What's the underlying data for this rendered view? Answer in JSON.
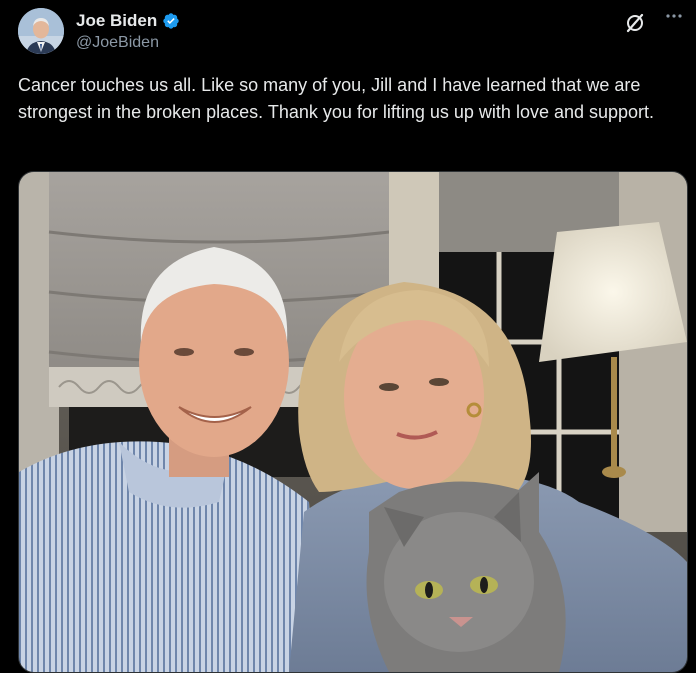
{
  "author": {
    "display_name": "Joe Biden",
    "handle": "@JoeBiden",
    "verified": true,
    "verified_color": "#1d9bf0"
  },
  "icons": {
    "verified": "verified-badge-icon",
    "grok": "grok-icon",
    "more": "more-options-icon"
  },
  "tweet": {
    "text": "Cancer touches us all. Like so many of you, Jill and I have learned that we are strongest in the broken places. Thank you for lifting us up with love and support."
  },
  "colors": {
    "background": "#000000",
    "text_primary": "#e7e9ea",
    "text_secondary": "#8b98a5"
  }
}
